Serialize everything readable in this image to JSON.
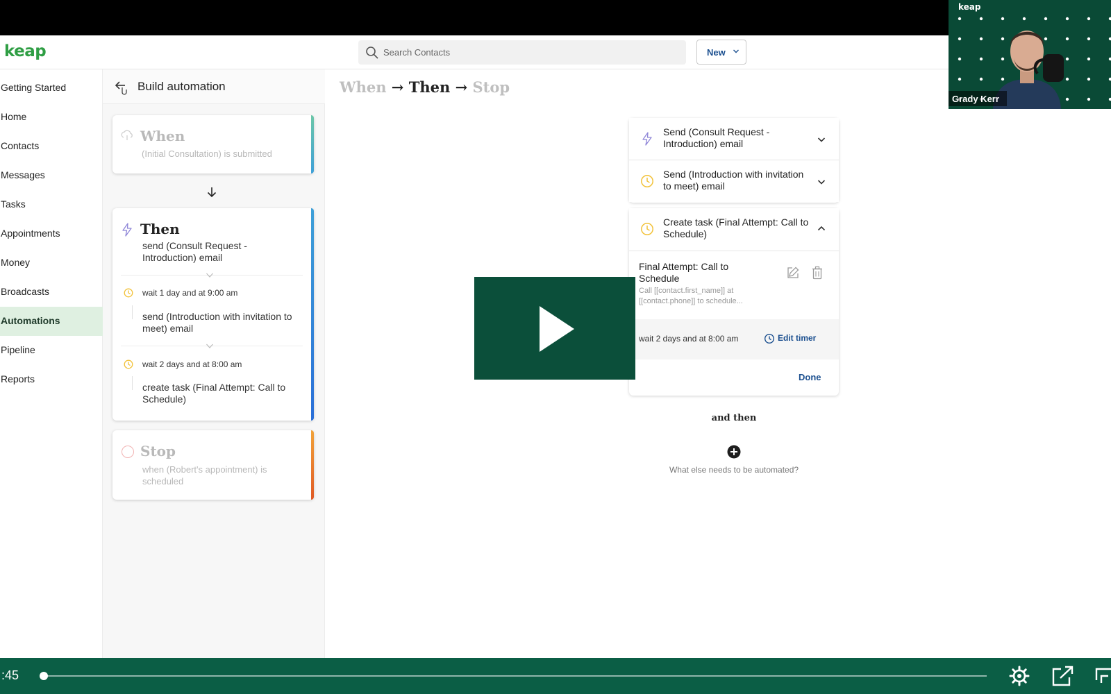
{
  "colors": {
    "brand": "#2f9e44",
    "link": "#1b4f8f",
    "player": "#0b5e45",
    "play_overlay": "#0b4f3a",
    "nav_active_bg": "#dff0e1"
  },
  "header": {
    "logo": "keap",
    "search_placeholder": "Search Contacts",
    "new_label": "New"
  },
  "sidebar": {
    "items": [
      {
        "label": "Getting Started"
      },
      {
        "label": "Home"
      },
      {
        "label": "Contacts"
      },
      {
        "label": "Messages"
      },
      {
        "label": "Tasks"
      },
      {
        "label": "Appointments"
      },
      {
        "label": "Money"
      },
      {
        "label": "Broadcasts"
      },
      {
        "label": "Automations",
        "active": true
      },
      {
        "label": "Pipeline"
      },
      {
        "label": "Reports"
      }
    ]
  },
  "panel": {
    "title": "Build automation",
    "when": {
      "title": "When",
      "subtitle": "(Initial Consultation) is submitted"
    },
    "then": {
      "title": "Then",
      "first_action": "send (Consult Request - Introduction) email",
      "steps": [
        {
          "wait": "wait 1 day and at 9:00 am",
          "action": "send (Introduction with invitation to meet) email"
        },
        {
          "wait": "wait 2 days and at 8:00 am",
          "action": "create task (Final Attempt: Call to Schedule)"
        }
      ]
    },
    "stop": {
      "title": "Stop",
      "subtitle": "when (Robert's appointment) is scheduled"
    }
  },
  "main": {
    "breadcrumb": {
      "when": "When",
      "arrow": "→",
      "then": "Then",
      "stop": "Stop"
    },
    "steps": [
      {
        "icon": "bolt-icon",
        "label": "Send (Consult Request - Introduction) email"
      },
      {
        "icon": "clock-icon",
        "label": "Send (Introduction with invitation to meet) email"
      },
      {
        "icon": "clock-icon",
        "label": "Create task (Final Attempt: Call to Schedule)"
      }
    ],
    "task": {
      "title": "Final Attempt: Call to Schedule",
      "description": "Call [[contact.first_name]] at [[contact.phone]] to schedule...",
      "timer": "wait 2 days and at 8:00 am",
      "edit_timer": "Edit timer",
      "done": "Done"
    },
    "and_then": "and then",
    "add_hint": "What else needs to be automated?"
  },
  "webcam": {
    "logo": "keap",
    "name": "Grady Kerr"
  },
  "player": {
    "time": ":45",
    "progress": 0.003
  }
}
